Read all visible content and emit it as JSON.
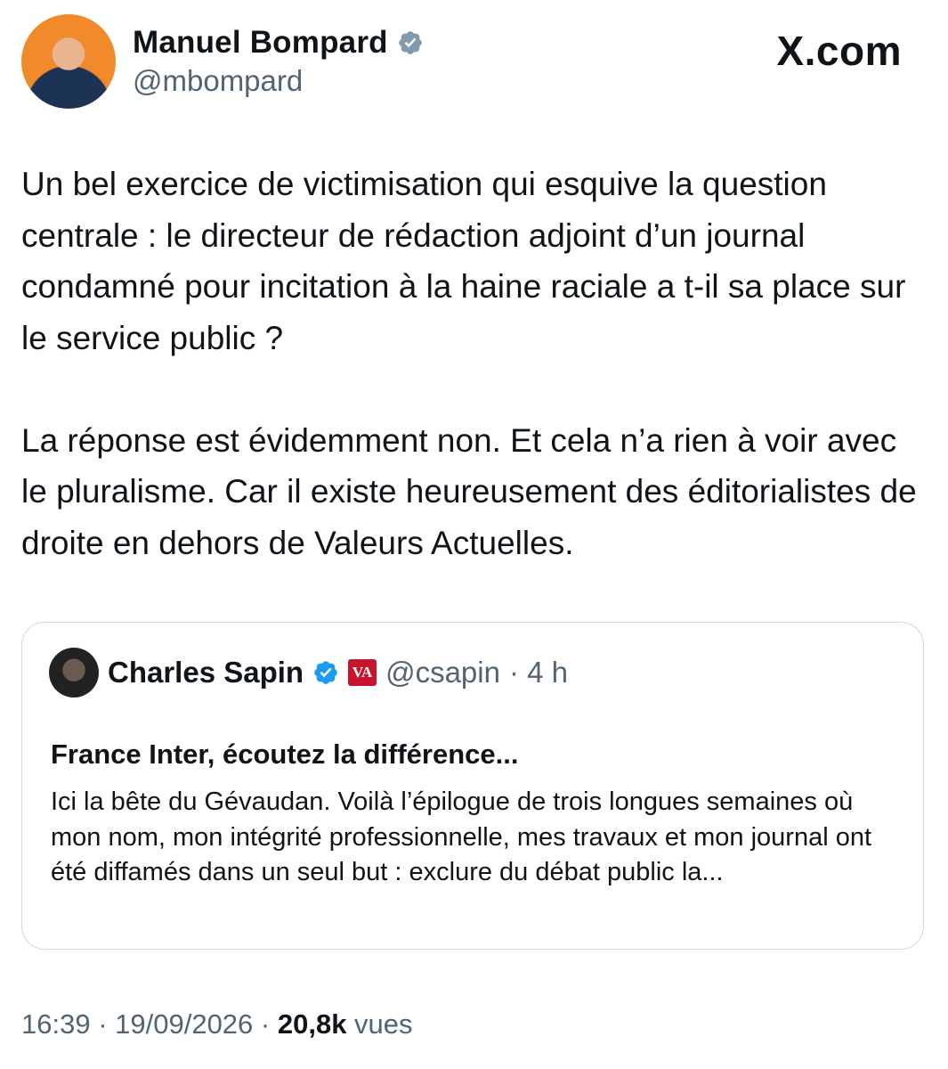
{
  "author": {
    "name": "Manuel Bompard",
    "handle": "@mbompard",
    "verified_icon": "verified-badge-gray"
  },
  "brand": "X.com",
  "tweet": {
    "paragraph_1": "Un bel exercice de victimisation qui esquive la question centrale : le directeur de rédaction adjoint d’un journal condamné pour incitation à la haine raciale a t-il sa place sur le service public ?",
    "paragraph_2": "La réponse est évidemment non. Et cela n’a rien à voir avec le pluralisme. Car il existe heureusement des éditorialistes de droite en dehors de Valeurs Actuelles."
  },
  "quoted": {
    "name": "Charles Sapin",
    "verified_icon": "verified-badge-blue",
    "affiliation_label": "VA",
    "handle": "@csapin",
    "time": "· 4 h",
    "title": "France Inter, écoutez la différence...",
    "body": "Ici la bête du Gévaudan. Voilà l’épilogue de trois longues semaines où mon nom, mon intégrité professionnelle, mes travaux et mon journal ont été diffamés dans un seul but : exclure du débat public la..."
  },
  "footer": {
    "time": "16:39",
    "sep1": " · ",
    "date": "19/09/2026",
    "sep2": " · ",
    "views": "20,8k",
    "views_label": " vues"
  },
  "colors": {
    "text": "#0f1419",
    "muted": "#536471",
    "border": "#cfd9de",
    "verified_blue": "#1d9bf0",
    "verified_gray": "#829aab",
    "va_red": "#c8142e"
  }
}
